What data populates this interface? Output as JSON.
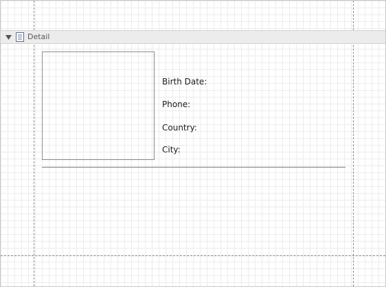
{
  "detail_band": {
    "title": "Detail",
    "collapse_icon": "triangle-down-icon",
    "band_icon": "report-band-icon"
  },
  "fields": {
    "birth_date_label": "Birth Date:",
    "phone_label": "Phone:",
    "country_label": "Country:",
    "city_label": "City:"
  },
  "colors": {
    "grid": "#ececec",
    "band_header_bg": "#ececec",
    "guide_line": "#8c8c8c",
    "control_border": "#8a8a8a"
  }
}
